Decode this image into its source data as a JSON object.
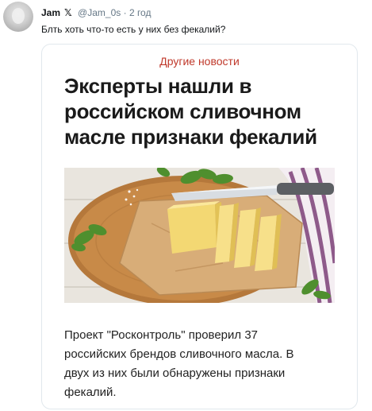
{
  "tweet": {
    "author_name": "Jam",
    "verified_mark": "𝕏",
    "handle": "@Jam_0s",
    "separator": "·",
    "time": "2 год",
    "text": "Блть хоть что-то есть у них без фекалий?"
  },
  "card": {
    "section_label": "Другие новости",
    "section_color": "#c0392b",
    "headline_lines": [
      "Эксперты нашли в",
      "российском сливочном",
      "масле признаки фекалий"
    ],
    "body_lines": [
      "Проект \"Росконтроль\" проверил 37",
      "российских брендов сливочного масла. В",
      "двух из них были обнаружены признаки",
      "фекалий."
    ]
  }
}
